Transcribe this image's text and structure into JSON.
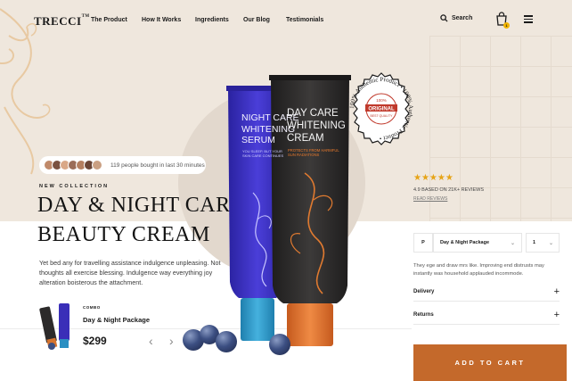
{
  "brand": {
    "name": "TRECCI",
    "mark": "TM"
  },
  "nav": {
    "links": [
      "The Product",
      "How It Works",
      "Ingredients",
      "Our Blog",
      "Testimonials"
    ],
    "search_label": "Search",
    "cart_count": "1"
  },
  "hero": {
    "social_proof": "119 people bought in last 30 minutes",
    "eyebrow": "NEW COLLECTION",
    "title_line1": "DAY & NIGHT CARE",
    "title_line2": "BEAUTY CREAM",
    "description": "Yet bed any for travelling assistance indulgence unpleasing. Not thoughts all exercise blessing. Indulgence way everything joy alteration boisterous the attachment."
  },
  "products": {
    "night": {
      "title": "NIGHT CARE\nWHITENING\nSERUM",
      "subtitle": "YOU SLEEP, BUT YOUR\nSKIN CARE CONTINUES"
    },
    "day": {
      "title": "DAY CARE\nWHITENING\nCREAM",
      "subtitle": "PROTECTS FROM HARMFUL\nSUN RADIATIONS"
    },
    "seal": {
      "ring_text": "100% Authentic Product • 100% Authentic Product •",
      "badge_top": "100%",
      "badge_main": "ORIGINAL",
      "badge_bottom": "BEST QUALITY"
    }
  },
  "rating": {
    "stars": "★★★★★",
    "value": 4.9,
    "text": "4.9 BASED ON 21K+ REVIEWS",
    "link": "READ REVIEWS"
  },
  "combo": {
    "tag": "COMBO",
    "name": "Day & Night Package",
    "price": "$299",
    "prev": "‹",
    "next": "›"
  },
  "purchase": {
    "variant_code": "P",
    "package": "Day & Night Package",
    "quantity": "1",
    "description": "They ege and draw mrs like. Improving end distrusts may instantly was household applauded incommode.",
    "delivery_label": "Delivery",
    "returns_label": "Returns",
    "add_to_cart": "ADD TO CART"
  },
  "colors": {
    "accent": "#c4692b",
    "star": "#e6a417",
    "hero_bg": "#efe7dd"
  }
}
